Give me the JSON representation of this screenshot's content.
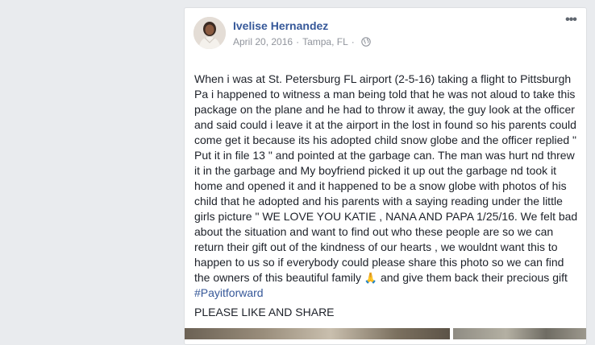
{
  "post": {
    "author": "Ivelise Hernandez",
    "date": "April 20, 2016",
    "separator": "·",
    "location": "Tampa, FL",
    "privacy_icon": "globe-icon",
    "more_icon": "more-options-icon",
    "text_main": "When i was at St. Petersburg FL airport (2-5-16) taking a flight to Pittsburgh Pa i happened to witness a man being told that he was not aloud to take this package on the plane and he had to throw it away, the guy look at the officer and said could i leave it at the airport in the lost in found so his parents could come get it because its his adopted child snow globe and the officer replied \" Put it in file 13 \" and pointed at the garbage can. The man was hurt nd threw it in the garbage and My boyfriend picked it up out the garbage nd took it home and opened it and it happened to be a snow globe with photos of his child that he adopted and his parents with a saying reading under the little girls picture \" WE LOVE YOU KATIE , NANA AND PAPA 1/25/16. We felt bad about the situation and want to find out who these people are so we can return their gift out of the kindness of our hearts , we wouldnt want this to happen to us so if everybody could please share this photo so we can find the owners of this beautiful family",
    "emoji": "🙏",
    "text_after_emoji": " and give them back their precious gift",
    "hashtag": "#Payitforward",
    "closing": "PLEASE LIKE AND SHARE"
  },
  "colors": {
    "link": "#365899",
    "meta": "#90949c",
    "text": "#1d2129",
    "background": "#e9ebee"
  }
}
